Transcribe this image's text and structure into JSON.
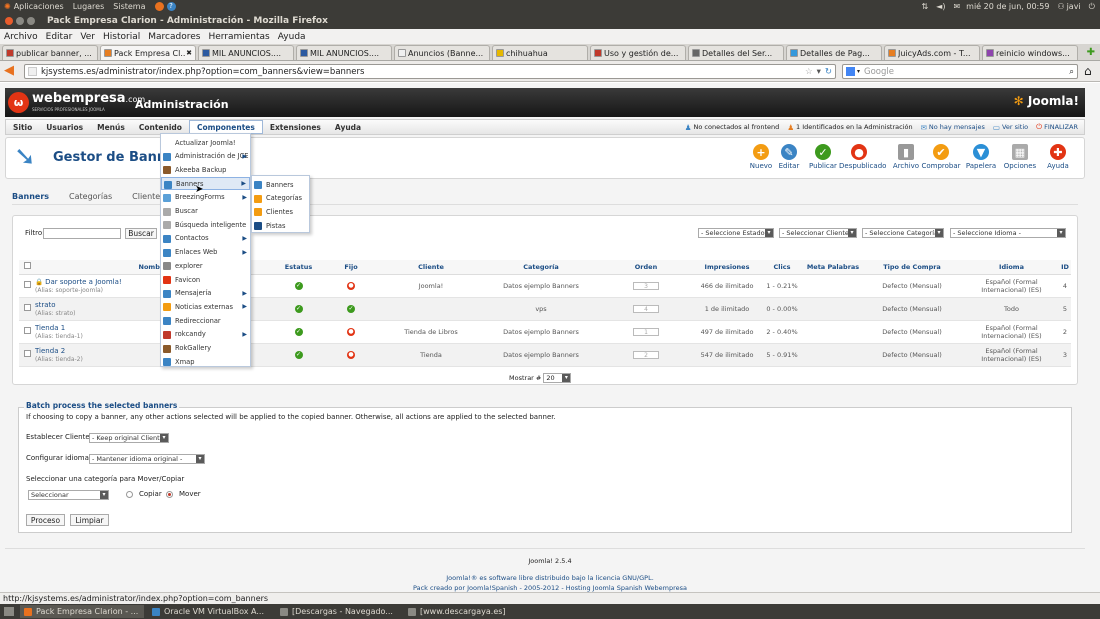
{
  "gnome_panel": {
    "menus": [
      "Aplicaciones",
      "Lugares",
      "Sistema"
    ],
    "clock": "mié 20 de jun, 00:59",
    "user": "javi"
  },
  "window": {
    "title": "Pack Empresa Clarion - Administración - Mozilla Firefox"
  },
  "ff_menu": [
    "Archivo",
    "Editar",
    "Ver",
    "Historial",
    "Marcadores",
    "Herramientas",
    "Ayuda"
  ],
  "tabs": [
    {
      "label": "publicar banner, ...",
      "active": false,
      "color": "#c0392b"
    },
    {
      "label": "Pack Empresa Cl...",
      "active": true,
      "color": "#e67e22"
    },
    {
      "label": "MIL ANUNCIOS....",
      "active": false,
      "color": "#2c5aa0"
    },
    {
      "label": "MIL ANUNCIOS....",
      "active": false,
      "color": "#2c5aa0"
    },
    {
      "label": "Anuncios (Banne...",
      "active": false,
      "color": "#f0f0f0"
    },
    {
      "label": "chihuahua",
      "active": false,
      "color": "#e6b800"
    },
    {
      "label": "Uso y gestión de...",
      "active": false,
      "color": "#c0392b"
    },
    {
      "label": "Detalles del Ser...",
      "active": false,
      "color": "#666666"
    },
    {
      "label": "Detalles de Pag...",
      "active": false,
      "color": "#3498db"
    },
    {
      "label": "JuicyAds.com - T...",
      "active": false,
      "color": "#e67e22"
    },
    {
      "label": "reinicio windows...",
      "active": false,
      "color": "#8e44ad"
    }
  ],
  "nav": {
    "url": "kjsystems.es/administrator/index.php?option=com_banners&view=banners",
    "search_placeholder": "Google"
  },
  "joomla": {
    "brand": "webempresa",
    "brand_suffix": ".com",
    "brand_tag": "SERVICIOS PROFESIONALES JOOMLA",
    "admin_title": "Administración",
    "logo": "Joomla!",
    "menu": [
      "Sitio",
      "Usuarios",
      "Menús",
      "Contenido",
      "Componentes",
      "Extensiones",
      "Ayuda"
    ],
    "status_items": [
      "No conectados al frontend",
      "1 Identificados en la Administración",
      "No hay mensajes",
      "Ver sitio",
      "FINALIZAR"
    ]
  },
  "page_title": "Gestor de Banners",
  "toolbar": [
    {
      "label": "Nuevo",
      "color": "#f39c12",
      "glyph": "+"
    },
    {
      "label": "Editar",
      "color": "#3b84c4",
      "glyph": "✎"
    },
    {
      "label": "Publicar",
      "color": "#3d9a1e",
      "glyph": "✓"
    },
    {
      "label": "Despublicado",
      "color": "#e23414",
      "glyph": "●"
    },
    {
      "label": "Archivo",
      "color": "#999999",
      "glyph": "▮"
    },
    {
      "label": "Comprobar",
      "color": "#f39c12",
      "glyph": "✔"
    },
    {
      "label": "Papelera",
      "color": "#2b8fd6",
      "glyph": "▼"
    },
    {
      "label": "Opciones",
      "color": "#aaaaaa",
      "glyph": "▦"
    },
    {
      "label": "Ayuda",
      "color": "#e23414",
      "glyph": "✚"
    }
  ],
  "subtabs": [
    "Banners",
    "Categorías",
    "Clientes"
  ],
  "filter": {
    "label": "Filtro:",
    "search_button": "Buscar",
    "selects": [
      "- Seleccione Estado -",
      "- Seleccionar Cliente -",
      "- Seleccione Categoría -",
      "- Seleccione Idioma -"
    ]
  },
  "table": {
    "headers": [
      "Nombre",
      "Estatus",
      "Fijo",
      "Cliente",
      "Categoría",
      "Orden",
      "Impresiones",
      "Clics",
      "Meta Palabras",
      "Tipo de Compra",
      "Idioma",
      "ID"
    ],
    "rows": [
      {
        "name": "Dar soporte a Joomla!",
        "alias": "(Alias: soporte-joomla)",
        "locked": true,
        "status": "ok",
        "fixed": "no",
        "client": "Joomla!",
        "category": "Datos ejemplo Banners",
        "order": "3",
        "impressions": "466 de ilimitado",
        "clicks": "1 - 0.21%",
        "meta": "",
        "purchase": "Defecto (Mensual)",
        "language": "Español (Formal Internacional) (ES)",
        "id": "4"
      },
      {
        "name": "strato",
        "alias": "(Alias: strato)",
        "locked": false,
        "status": "ok",
        "fixed": "ok",
        "client": "",
        "category": "vps",
        "order": "4",
        "impressions": "1 de ilimitado",
        "clicks": "0 - 0.00%",
        "meta": "",
        "purchase": "Defecto (Mensual)",
        "language": "Todo",
        "id": "5"
      },
      {
        "name": "Tienda 1",
        "alias": "(Alias: tienda-1)",
        "locked": false,
        "status": "ok",
        "fixed": "no",
        "client": "Tienda de Libros",
        "category": "Datos ejemplo Banners",
        "order": "1",
        "impressions": "497 de ilimitado",
        "clicks": "2 - 0.40%",
        "meta": "",
        "purchase": "Defecto (Mensual)",
        "language": "Español (Formal Internacional) (ES)",
        "id": "2"
      },
      {
        "name": "Tienda 2",
        "alias": "(Alias: tienda-2)",
        "locked": false,
        "status": "ok",
        "fixed": "no",
        "client": "Tienda",
        "category": "Datos ejemplo Banners",
        "order": "2",
        "impressions": "547 de ilimitado",
        "clicks": "5 - 0.91%",
        "meta": "",
        "purchase": "Defecto (Mensual)",
        "language": "Español (Formal Internacional) (ES)",
        "id": "3"
      }
    ]
  },
  "pagination": {
    "label": "Mostrar #",
    "value": "20"
  },
  "batch": {
    "title": "Batch process the selected banners",
    "desc": "If choosing to copy a banner, any other actions selected will be applied to the copied banner. Otherwise, all actions are applied to the selected banner.",
    "client_label": "Establecer Cliente",
    "client_value": "- Keep original Client -",
    "lang_label": "Configurar idioma",
    "lang_value": "- Mantener idioma original -",
    "cat_label": "Seleccionar una categoría para Mover/Copiar",
    "cat_value": "Seleccionar",
    "copy": "Copiar",
    "move": "Mover",
    "process": "Proceso",
    "clear": "Limpiar"
  },
  "components_menu": [
    {
      "label": "Actualizar Joomla!",
      "sub": false,
      "color": ""
    },
    {
      "label": "Administración de JCE",
      "sub": true,
      "color": "#3b84c4"
    },
    {
      "label": "Akeeba Backup",
      "sub": false,
      "color": "#8b5a2b"
    },
    {
      "label": "Banners",
      "sub": true,
      "color": "#3b84c4",
      "hl": true
    },
    {
      "label": "BreezingForms",
      "sub": true,
      "color": "#5aa0d8"
    },
    {
      "label": "Buscar",
      "sub": false,
      "color": "#aaaaaa"
    },
    {
      "label": "Búsqueda inteligente",
      "sub": false,
      "color": "#aaaaaa"
    },
    {
      "label": "Contactos",
      "sub": true,
      "color": "#3b84c4"
    },
    {
      "label": "Enlaces Web",
      "sub": true,
      "color": "#3b84c4"
    },
    {
      "label": "explorer",
      "sub": false,
      "color": "#888888"
    },
    {
      "label": "Favicon",
      "sub": false,
      "color": "#e23414"
    },
    {
      "label": "Mensajería",
      "sub": true,
      "color": "#3b84c4"
    },
    {
      "label": "Noticias externas",
      "sub": true,
      "color": "#f39c12"
    },
    {
      "label": "Redireccionar",
      "sub": false,
      "color": "#3b84c4"
    },
    {
      "label": "rokcandy",
      "sub": true,
      "color": "#c0392b"
    },
    {
      "label": "RokGallery",
      "sub": false,
      "color": "#8b5a2b"
    },
    {
      "label": "Xmap",
      "sub": false,
      "color": "#3b84c4"
    }
  ],
  "banners_submenu": [
    "Banners",
    "Categorías",
    "Clientes",
    "Pistas"
  ],
  "footer": {
    "version": "Joomla! 2.5.4",
    "license": "Joomla!® es software libre distribuido bajo la licencia GNU/GPL.",
    "credits": "Pack creado por Joomla!Spanish - 2005-2012 - Hosting Joomla Spanish Webempresa"
  },
  "statusbar": "http://kjsystems.es/administrator/index.php?option=com_banners",
  "taskbar": [
    {
      "label": "Pack Empresa Clarion - ...",
      "active": true
    },
    {
      "label": "Oracle VM VirtualBox A...",
      "active": false
    },
    {
      "label": "[Descargas - Navegado...",
      "active": false
    },
    {
      "label": "[www.descargaya.es]",
      "active": false
    }
  ]
}
